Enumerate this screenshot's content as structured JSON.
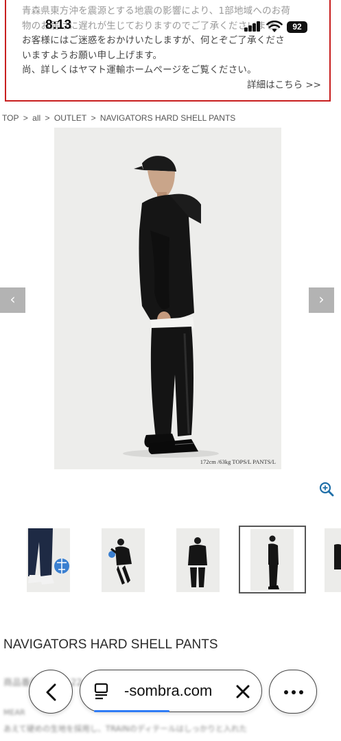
{
  "notice": {
    "line1": "青森県東方沖を震源とする地震の影響により、1部地域へのお荷",
    "line2": "物のお届けに遅れが生じておりますのでご了承くださいませ。",
    "line3": "お客様にはご迷惑をおかけいたしますが、何とぞご了承くださ",
    "line4": "いますようお願い申し上げます。",
    "line5": "尚、詳しくはヤマト運輸ホームページをご覧ください。",
    "more_link": "詳細はこちら >>"
  },
  "status_bar": {
    "time": "8:13",
    "battery": "92"
  },
  "breadcrumb": {
    "items": [
      "TOP",
      ">",
      "all",
      ">",
      "OUTLET",
      ">",
      "NAVIGATORS HARD SHELL PANTS"
    ]
  },
  "gallery": {
    "caption": "172cm /63kg TOPS/L PANTS/L",
    "prev_label": "‹",
    "next_label": "›",
    "thumbnails": [
      "thumb-1",
      "thumb-2",
      "thumb-3",
      "thumb-4-active",
      "thumb-5"
    ]
  },
  "product": {
    "title": "NAVIGATORS HARD SHELL PANTS",
    "code_label": "商品番号",
    "code_partial": "22",
    "desc_blur_1": "MEAR",
    "desc_blur_2": "あえて硬めの生地を採用し、TRAINのディテールはしっかりと入れた"
  },
  "browser": {
    "url": "-sombra.com"
  },
  "colors": {
    "notice_border": "#c81e1e",
    "progress": "#2f7cf6",
    "zoom_icon": "#1f6fa8"
  }
}
